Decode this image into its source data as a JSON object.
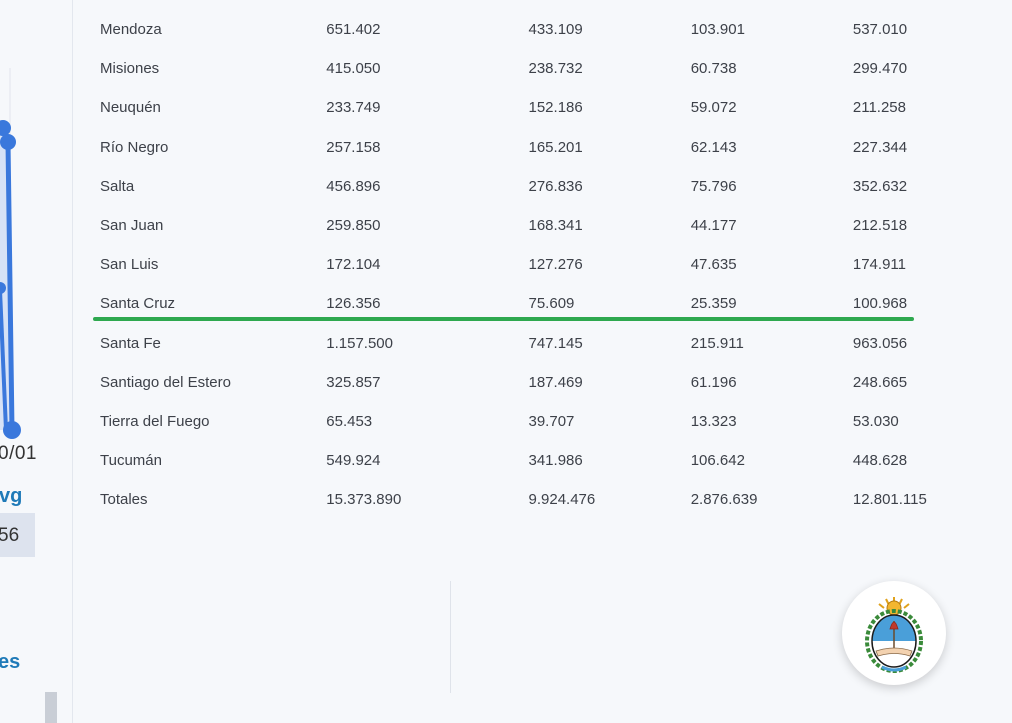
{
  "left_panel": {
    "date_fragment": "0/01",
    "avg_fragment": "vg",
    "value_fragment": "56",
    "section_fragment": "es"
  },
  "table": {
    "rows": [
      {
        "name": "Mendoza",
        "v1": "651.402",
        "v2": "433.109",
        "v3": "103.901",
        "v4": "537.010"
      },
      {
        "name": "Misiones",
        "v1": "415.050",
        "v2": "238.732",
        "v3": "60.738",
        "v4": "299.470"
      },
      {
        "name": "Neuquén",
        "v1": "233.749",
        "v2": "152.186",
        "v3": "59.072",
        "v4": "211.258"
      },
      {
        "name": "Río Negro",
        "v1": "257.158",
        "v2": "165.201",
        "v3": "62.143",
        "v4": "227.344"
      },
      {
        "name": "Salta",
        "v1": "456.896",
        "v2": "276.836",
        "v3": "75.796",
        "v4": "352.632"
      },
      {
        "name": "San Juan",
        "v1": "259.850",
        "v2": "168.341",
        "v3": "44.177",
        "v4": "212.518"
      },
      {
        "name": "San Luis",
        "v1": "172.104",
        "v2": "127.276",
        "v3": "47.635",
        "v4": "174.911"
      },
      {
        "name": "Santa Cruz",
        "v1": "126.356",
        "v2": "75.609",
        "v3": "25.359",
        "v4": "100.968"
      },
      {
        "name": "Santa Fe",
        "v1": "1.157.500",
        "v2": "747.145",
        "v3": "215.911",
        "v4": "963.056"
      },
      {
        "name": "Santiago del Estero",
        "v1": "325.857",
        "v2": "187.469",
        "v3": "61.196",
        "v4": "248.665"
      },
      {
        "name": "Tierra del Fuego",
        "v1": "65.453",
        "v2": "39.707",
        "v3": "13.323",
        "v4": "53.030"
      },
      {
        "name": "Tucumán",
        "v1": "549.924",
        "v2": "341.986",
        "v3": "106.642",
        "v4": "448.628"
      },
      {
        "name": "Totales",
        "v1": "15.373.890",
        "v2": "9.924.476",
        "v3": "2.876.639",
        "v4": "12.801.115"
      }
    ]
  },
  "colors": {
    "highlight": "#2ea84f",
    "accent": "#1f7ab8",
    "chart_line": "#3a78dc"
  },
  "icons": {
    "seal": "argentina-coat-of-arms-icon"
  }
}
